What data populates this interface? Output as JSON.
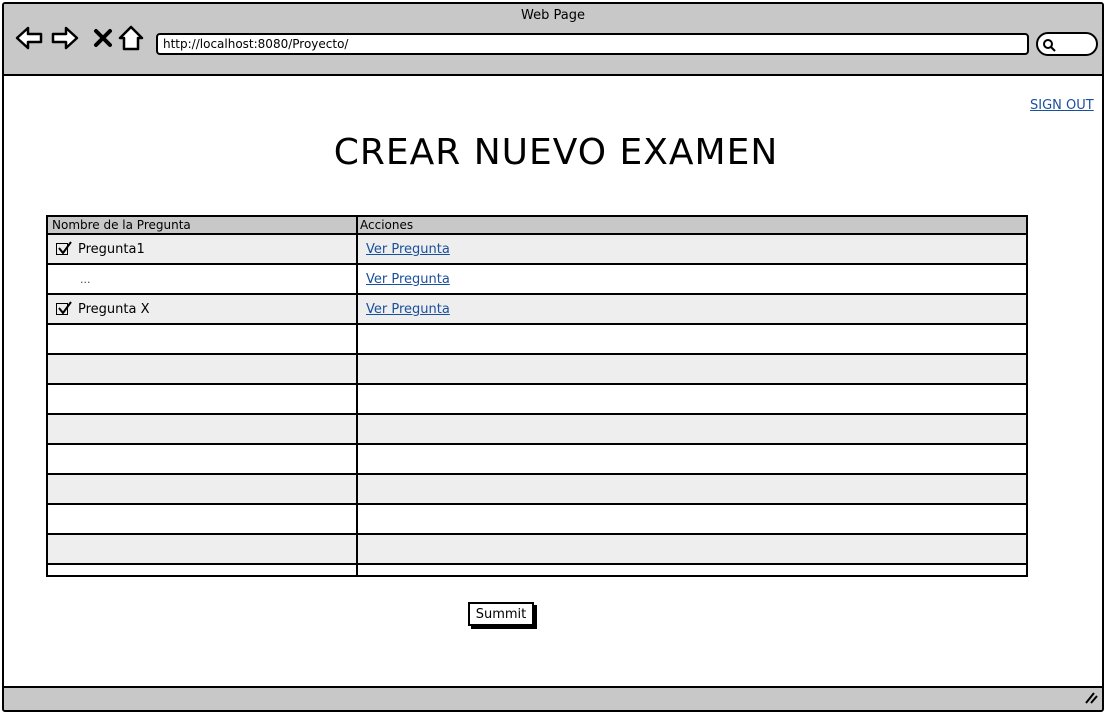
{
  "browser": {
    "title": "Web Page",
    "url": "http://localhost:8080/Proyecto/",
    "icons": {
      "back": "back-arrow-icon",
      "forward": "forward-arrow-icon",
      "stop": "close-icon",
      "home": "home-icon",
      "search": "search-icon"
    }
  },
  "header": {
    "signout_label": "SIGN OUT"
  },
  "main": {
    "title": "CREAR NUEVO EXAMEN",
    "table": {
      "columns": [
        "Nombre de la Pregunta",
        "Acciones"
      ],
      "rows": [
        {
          "name": "Pregunta1",
          "checked": true,
          "action": "Ver Pregunta"
        },
        {
          "name": "...",
          "checked": false,
          "action": "Ver Pregunta"
        },
        {
          "name": "Pregunta X",
          "checked": true,
          "action": "Ver Pregunta"
        }
      ],
      "empty_rows": 8
    },
    "submit_label": "Summit"
  },
  "colors": {
    "chrome": "#c8c8c8",
    "link": "#1a4f9c",
    "row_alt": "#eeeeee"
  }
}
